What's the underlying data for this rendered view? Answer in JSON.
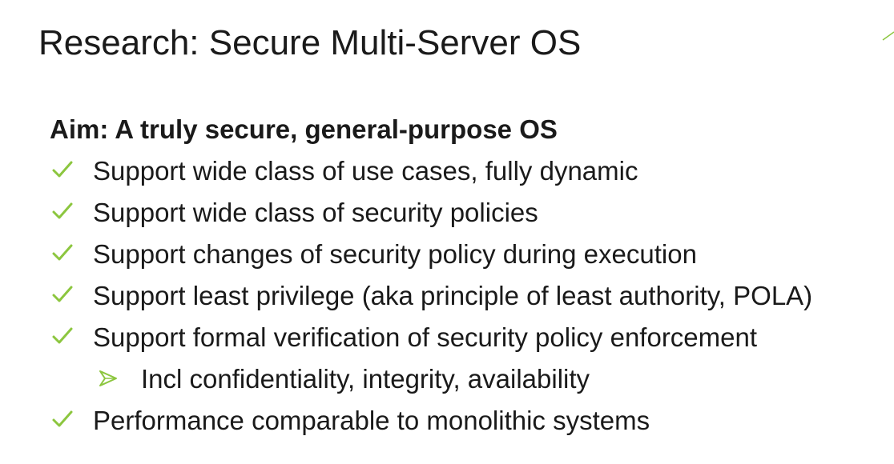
{
  "slide": {
    "title": "Research: Secure Multi-Server OS",
    "aim": "Aim: A truly secure, general-purpose OS",
    "accent_color": "#8cc63f",
    "bullets": [
      {
        "text": "Support wide class of use cases, fully dynamic",
        "level": 1,
        "marker": "check-icon"
      },
      {
        "text": "Support wide class of security policies",
        "level": 1,
        "marker": "check-icon"
      },
      {
        "text": "Support changes of security policy during execution",
        "level": 1,
        "marker": "check-icon"
      },
      {
        "text": "Support least privilege (aka principle of least authority, POLA)",
        "level": 1,
        "marker": "check-icon"
      },
      {
        "text": "Support formal verification of security policy enforcement",
        "level": 1,
        "marker": "check-icon"
      },
      {
        "text": "Incl confidentiality, integrity, availability",
        "level": 2,
        "marker": "arrow-right-icon"
      },
      {
        "text": "Performance comparable to monolithic systems",
        "level": 1,
        "marker": "check-icon"
      }
    ]
  }
}
